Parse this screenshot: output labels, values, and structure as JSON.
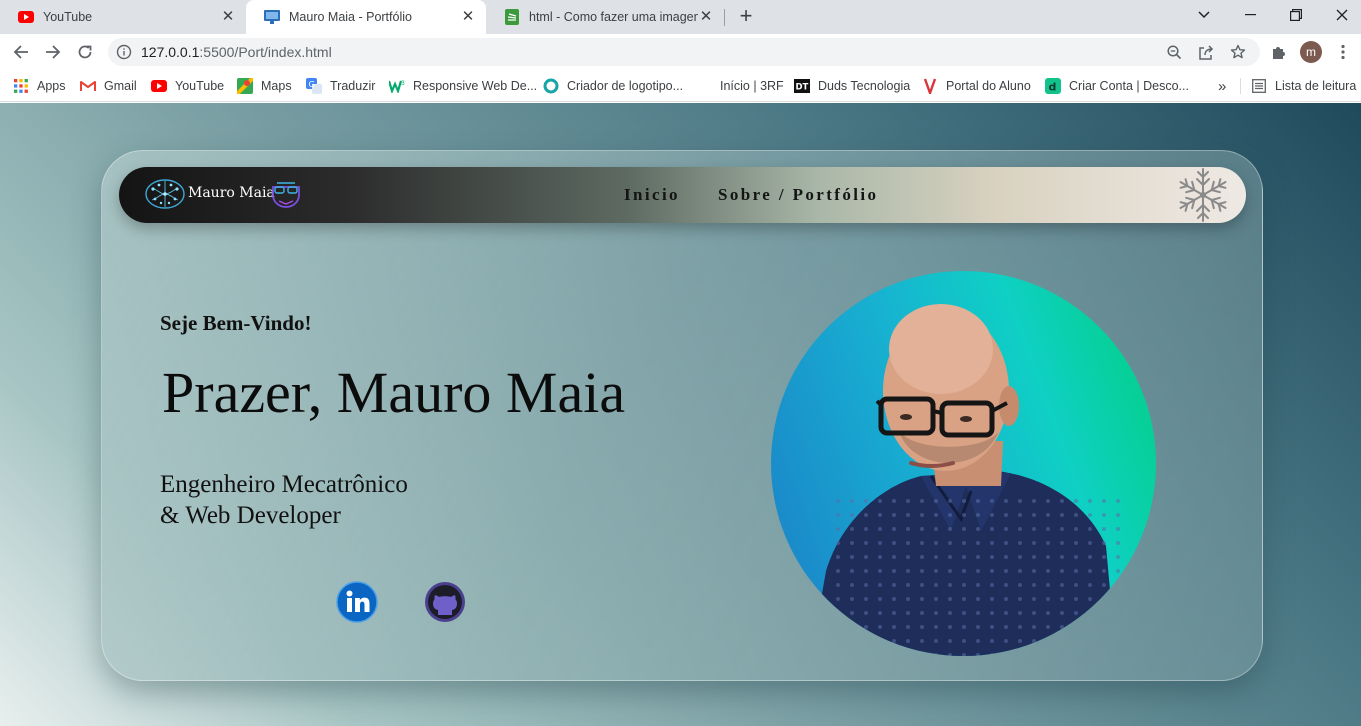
{
  "browser": {
    "tabs": [
      {
        "title": "YouTube",
        "favicon": "youtube-icon"
      },
      {
        "title": "Mauro Maia - Portfólio",
        "favicon": "monitor-icon",
        "active": true
      },
      {
        "title": "html - Como fazer uma imagem c",
        "favicon": "stackoverflow-icon"
      }
    ],
    "url_host": "127.0.0.1",
    "url_path": ":5500/Port/index.html",
    "profile_initial": "m",
    "bookmarks": [
      {
        "label": "Apps",
        "icon": "apps-grid-icon"
      },
      {
        "label": "Gmail",
        "icon": "gmail-icon"
      },
      {
        "label": "YouTube",
        "icon": "youtube-icon"
      },
      {
        "label": "Maps",
        "icon": "maps-icon"
      },
      {
        "label": "Traduzir",
        "icon": "translate-icon"
      },
      {
        "label": "Responsive Web De...",
        "icon": "w3-icon"
      },
      {
        "label": "Criador de logotipo...",
        "icon": "logo-maker-icon"
      },
      {
        "label": "Início | 3RF",
        "icon": ""
      },
      {
        "label": "Duds Tecnologia",
        "icon": "dt-icon"
      },
      {
        "label": "Portal do Aluno",
        "icon": "portal-icon"
      },
      {
        "label": "Criar Conta | Desco...",
        "icon": "d-icon"
      }
    ],
    "reading_list": "Lista de leitura"
  },
  "page": {
    "logo_text": "Mauro Maia",
    "nav": {
      "home": "Inicio",
      "about": "Sobre / Portfólio"
    },
    "greeting": "Seje Bem-Vindo!",
    "heading": "Prazer, Mauro Maia",
    "role_line1": "Engenheiro Mecatrônico",
    "role_line2": "& Web Developer",
    "social": [
      {
        "name": "LinkedIn",
        "icon": "linkedin-icon",
        "color": "#0a66c2"
      },
      {
        "name": "GitHub",
        "icon": "github-icon",
        "color": "#4b3f8f"
      }
    ],
    "colors": {
      "photo_gradient_start": "#1c7ec8",
      "photo_gradient_end": "#00d07a"
    }
  }
}
